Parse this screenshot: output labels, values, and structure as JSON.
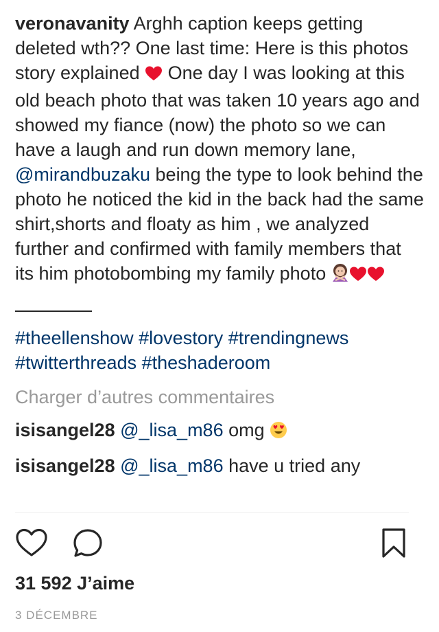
{
  "caption": {
    "username": "veronavanity",
    "text_before_heart": "Arghh caption keeps getting deleted wth?? One last time: Here is this photos story explained",
    "text_after_heart": "One day I was looking at this old beach photo that was taken 10 years ago and showed my fiance (now) the photo so we can have a laugh and run down memory lane,",
    "mention": "@mirandbuzaku",
    "text_after_mention": "being the type to look behind the photo he noticed the kid in the back had the same shirt,shorts and floaty as him , we analyzed further and confirmed with family members that its him photobombing my family photo",
    "emoji_heart": "heart-emoji",
    "emoji_end": [
      "woman-gesturing-no-emoji",
      "heart-emoji",
      "heart-emoji"
    ]
  },
  "hashtags": [
    "#theellenshow",
    "#lovestory",
    "#trendingnews",
    "#twitterthreads",
    "#theshaderoom"
  ],
  "load_more_label": "Charger d’autres commentaires",
  "comments": [
    {
      "username": "isisangel28",
      "mention": "@_lisa_m86",
      "text": "omg",
      "emoji": "heart-eyes-emoji"
    },
    {
      "username": "isisangel28",
      "mention": "@_lisa_m86",
      "text": "have u tried any",
      "emoji": ""
    }
  ],
  "actions": {
    "like_icon": "heart-outline-icon",
    "comment_icon": "speech-bubble-icon",
    "save_icon": "bookmark-icon"
  },
  "likes_text": "31 592 J’aime",
  "date_text": "3 DÉCEMBRE",
  "colors": {
    "text": "#262626",
    "link": "#003569",
    "muted": "#999999",
    "heart_red": "#e8112d"
  }
}
